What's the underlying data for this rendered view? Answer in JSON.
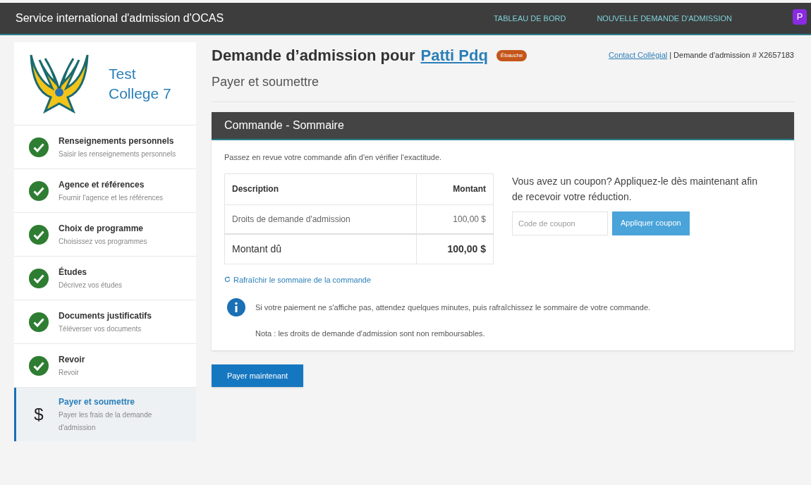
{
  "header": {
    "title": "Service international d'admission d'OCAS",
    "nav": [
      {
        "label": "TABLEAU DE BORD"
      },
      {
        "label": "NOUVELLE DEMANDE D'ADMISSION"
      }
    ],
    "avatar": "P"
  },
  "college": {
    "name": "Test College 7"
  },
  "steps": [
    {
      "title": "Renseignements personnels",
      "subtitle": "Saisir les renseignements personnels",
      "completed": true,
      "selected": false
    },
    {
      "title": "Agence et références",
      "subtitle": "Fournir l'agence et les références",
      "completed": true,
      "selected": false
    },
    {
      "title": "Choix de programme",
      "subtitle": "Choisissez vos programmes",
      "completed": true,
      "selected": false
    },
    {
      "title": "Études",
      "subtitle": "Décrivez vos études",
      "completed": true,
      "selected": false
    },
    {
      "title": "Documents justificatifs",
      "subtitle": "Téléverser vos documents",
      "completed": true,
      "selected": false
    },
    {
      "title": "Revoir",
      "subtitle": "Revoir",
      "completed": true,
      "selected": false
    },
    {
      "title": "Payer et soumettre",
      "subtitle": "Payer les frais de la demande d'admission",
      "completed": false,
      "selected": true,
      "icon": "$"
    }
  ],
  "page": {
    "heading": "Demande d’admission pour",
    "applicant": "Patti Pdq",
    "badge": "Ébauche",
    "contact_link": "Contact Collégial",
    "separator": "|",
    "application_number": "Demande d'admission # X2657183",
    "subtitle": "Payer et soumettre"
  },
  "summary": {
    "title": "Commande - Sommaire",
    "intro": "Passez en revue votre commande afin d'en vérifier l'exactitude.",
    "columns": [
      "Description",
      "Montant"
    ],
    "rows": [
      {
        "description": "Droits de demande d'admission",
        "amount": "100,00 $",
        "kind": "item"
      },
      {
        "description": "Montant dû",
        "amount": "100,00 $",
        "kind": "total"
      }
    ],
    "coupon_text": "Vous avez un coupon? Appliquez-le dès maintenant afin de recevoir votre réduction.",
    "coupon_placeholder": "Code de coupon",
    "coupon_button": "Appliquer coupon",
    "refresh_link": "Rafraîchir le sommaire de la commande",
    "info": "Si votre paiement ne s'affiche pas, attendez quelques minutes, puis rafraîchissez le sommaire de votre commande.",
    "note": "Nota : les droits de demande d'admission sont non remboursables."
  },
  "pay_button": "Payer maintenant"
}
